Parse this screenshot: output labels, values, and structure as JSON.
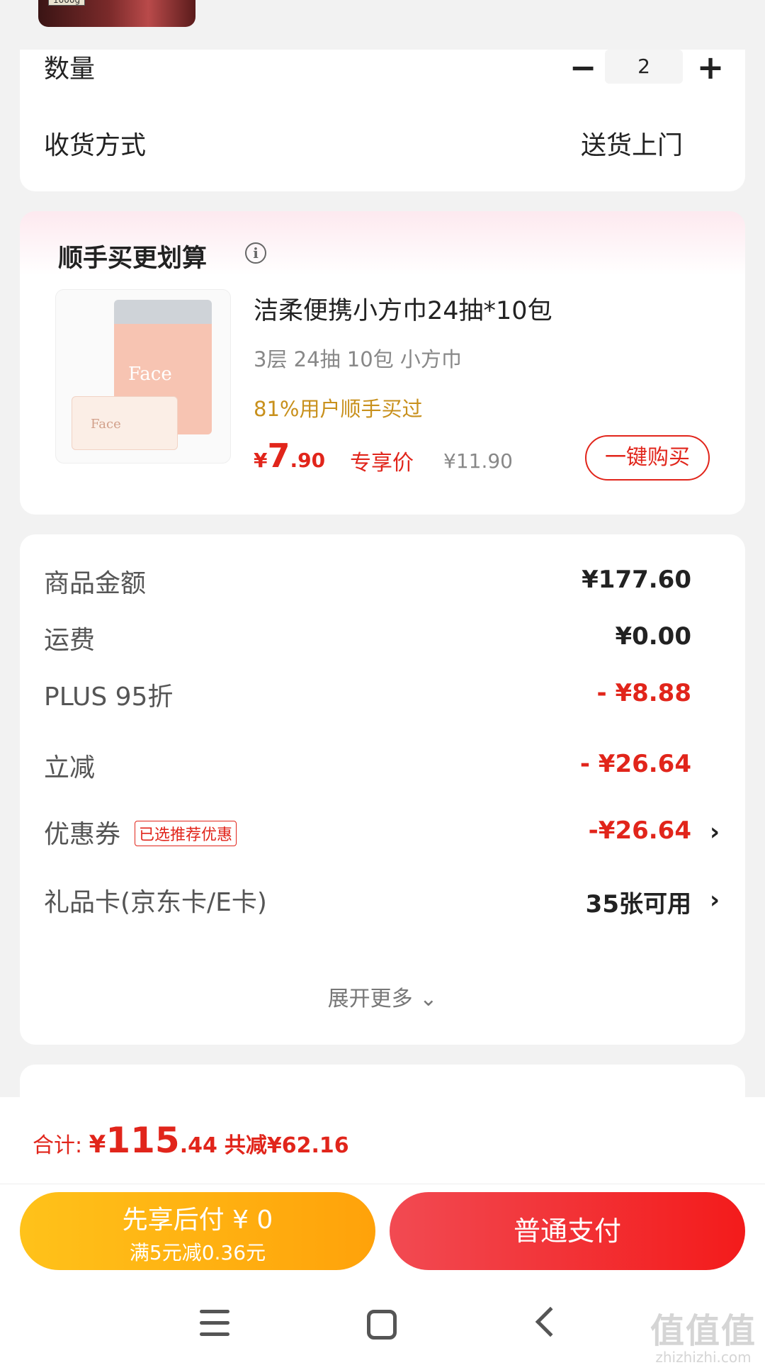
{
  "product_top": {
    "weight_tag": "1000g"
  },
  "order": {
    "quantity_label": "数量",
    "minus": "−",
    "quantity_value": "2",
    "plus": "+",
    "delivery_label": "收货方式",
    "delivery_value": "送货上门"
  },
  "recommend": {
    "title": "顺手买更划算",
    "info_icon": "i",
    "item": {
      "image_text_1": "Face",
      "image_text_2": "Face",
      "name": "洁柔便携小方巾24抽*10包",
      "spec": "3层 24抽 10包 小方巾",
      "bought": "81%用户顺手买过",
      "price_currency": "¥",
      "price_int": "7",
      "price_dec": ".90",
      "exclusive_label": "专享价",
      "original_price": "¥11.90",
      "buy_button": "一键购买"
    }
  },
  "summary": {
    "rows": [
      {
        "label": "商品金额",
        "value": "¥177.60"
      },
      {
        "label": "运费",
        "value": "¥0.00"
      },
      {
        "label": "PLUS 95折",
        "value": "- ¥8.88"
      },
      {
        "label": "立减",
        "value": "- ¥26.64"
      },
      {
        "label": "优惠券",
        "badge": "已选推荐优惠",
        "value": "-¥26.64"
      },
      {
        "label": "礼品卡(京东卡/E卡)",
        "value": "35张可用"
      }
    ],
    "chevron": "›",
    "expand": "展开更多 ⌄"
  },
  "footer": {
    "total_label": "合计: ",
    "total_currency": "¥",
    "total_int": "115",
    "total_dec": ".44",
    "saved": "共减¥62.16",
    "pay_later_line1": "先享后付 ¥ 0",
    "pay_later_line2": "满5元减0.36元",
    "pay_button": "普通支付"
  },
  "watermark": {
    "logo": "值值值",
    "url": "zhizhizhi.com"
  },
  "colors": {
    "accent_red": "#e1251b",
    "pay_later_yellow": "#ffb412",
    "bought_gold": "#c8901c"
  }
}
